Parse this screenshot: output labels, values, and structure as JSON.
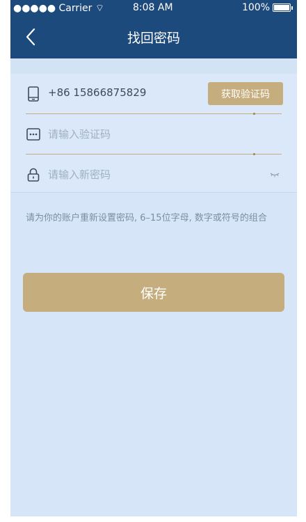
{
  "status_bar": {
    "carrier": "●●●●● Carrier ⌔",
    "time": "8:08 AM",
    "battery": "100%",
    "battery_icon": "battery-full-icon"
  },
  "nav": {
    "back_icon": "chevron-left-icon",
    "title": "找回密码"
  },
  "form": {
    "phone": {
      "icon": "phone-icon",
      "value": "+86  15866875829"
    },
    "get_code_label": "获取验证码",
    "code": {
      "icon": "message-dots-icon",
      "placeholder": "请输入验证码"
    },
    "password": {
      "icon": "lock-icon",
      "placeholder": "请输入新密码",
      "toggle_icon": "eye-closed-icon"
    }
  },
  "hint": "请为你的账户重新设置密码, 6–15位字母, 数字或符号的组合",
  "save_label": "保存",
  "colors": {
    "nav_bg": "#1d4a7c",
    "page_bg": "#d6e5f7",
    "accent_gold": "#c6ad7d",
    "text": "#3b4a5c",
    "placeholder": "#9fb0c4"
  }
}
